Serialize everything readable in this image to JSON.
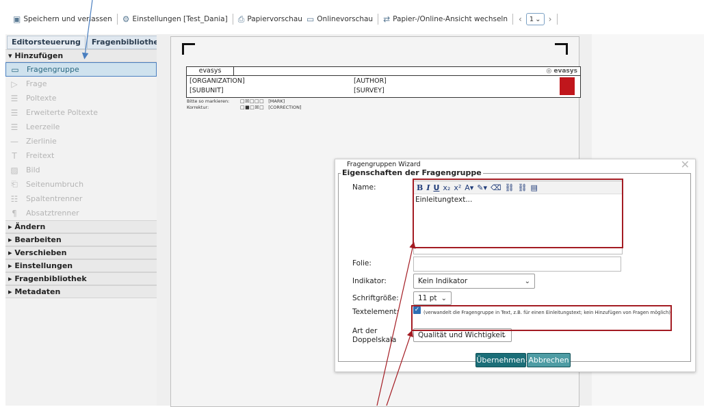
{
  "toolbar": {
    "save_label": "Speichern und verlassen",
    "settings_label": "Einstellungen [Test_Dania]",
    "paper_preview_label": "Papiervorschau",
    "online_preview_label": "Onlinevorschau",
    "switch_view_label": "Papier-/Online-Ansicht wechseln",
    "page_number": "1"
  },
  "sidebar": {
    "tabs": [
      "Editorsteuerung",
      "Fragenbibliothek"
    ],
    "add_section": "Hinzufügen",
    "items": [
      {
        "label": "Fragengruppe",
        "icon": "folder-icon"
      },
      {
        "label": "Frage",
        "icon": "speech-icon"
      },
      {
        "label": "Poltexte",
        "icon": "lines-icon"
      },
      {
        "label": "Erweiterte Poltexte",
        "icon": "lines-icon"
      },
      {
        "label": "Leerzeile",
        "icon": "empty-line-icon"
      },
      {
        "label": "Zierlinie",
        "icon": "line-icon"
      },
      {
        "label": "Freitext",
        "icon": "text-icon"
      },
      {
        "label": "Bild",
        "icon": "image-icon"
      },
      {
        "label": "Seitenumbruch",
        "icon": "page-break-icon"
      },
      {
        "label": "Spaltentrenner",
        "icon": "columns-icon"
      },
      {
        "label": "Absatztrenner",
        "icon": "pilcrow-icon"
      }
    ],
    "sections": [
      "Ändern",
      "Bearbeiten",
      "Verschieben",
      "Einstellungen",
      "Fragenbibliothek",
      "Metadaten"
    ]
  },
  "page_header": {
    "brand": "evasys",
    "logo_text": "evasys",
    "organization": "[ORGANIZATION]",
    "author": "[AUTHOR]",
    "subunit": "[SUBUNIT]",
    "survey": "[SURVEY]",
    "mark_label": "Bitte so markieren:",
    "mark_boxes": "□☒□□□",
    "mark_value": "[MARK]",
    "correction_label": "Korrektur:",
    "correction_boxes": "□■□☒□",
    "correction_value": "[CORRECTION]"
  },
  "dialog": {
    "title": "Fragengruppen Wizard",
    "legend": "Eigenschaften der Fragengruppe",
    "name_label": "Name:",
    "editor_text": "Einleitungtext...",
    "folie_label": "Folie:",
    "indikator_label": "Indikator:",
    "indikator_value": "Kein Indikator",
    "font_size_label": "Schriftgröße:",
    "font_size_value": "11 pt",
    "text_element_label": "Textelement:",
    "text_element_checked": true,
    "text_element_desc": "(verwandelt die Fragengruppe in Text, z.B. für einen Einleitungstext; kein Hinzufügen von Fragen möglich)",
    "scale_label_1": "Art der",
    "scale_label_2": "Doppelskala",
    "scale_value": "Qualität und Wichtigkeit",
    "apply_label": "Übernehmen",
    "cancel_label": "Abbrechen"
  }
}
